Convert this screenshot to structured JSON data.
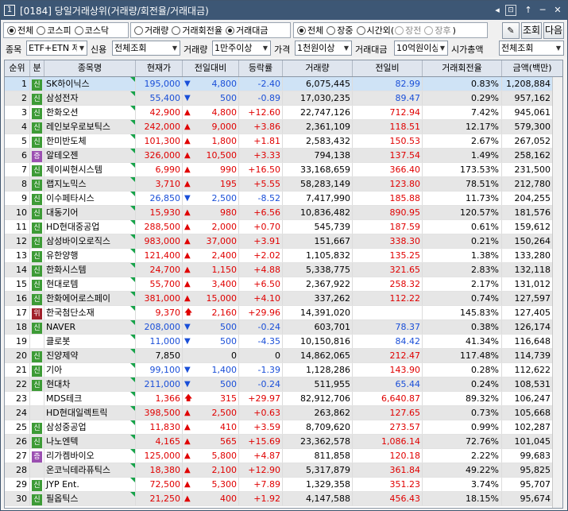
{
  "window": {
    "num": "1",
    "title": "[0184] 당일거래상위(거래량/회전율/거래대금)",
    "controls": [
      "◂",
      "▸",
      "⊡",
      "↑",
      "─",
      "✕"
    ]
  },
  "toolbar": {
    "market": [
      {
        "label": "전체",
        "on": true
      },
      {
        "label": "코스피",
        "on": false
      },
      {
        "label": "코스닥",
        "on": false
      }
    ],
    "sort": [
      {
        "label": "거래량",
        "on": false
      },
      {
        "label": "거래회전율",
        "on": false
      },
      {
        "label": "거래대금",
        "on": true
      }
    ],
    "session": [
      {
        "label": "전체",
        "on": true
      },
      {
        "label": "장중",
        "on": false
      },
      {
        "label": "시간외(",
        "on": false
      },
      {
        "label": "장전",
        "on": false,
        "dis": true
      },
      {
        "label": "장후",
        "on": false,
        "dis": true
      },
      {
        "label": ")",
        "on": false
      }
    ],
    "lookup": "조회",
    "next": "다음"
  },
  "filters": {
    "type_label": "종목",
    "type_value": "ETF+ETN 제",
    "credit_label": "신용",
    "credit_value": "전체조회",
    "volume_label": "거래량",
    "volume_value": "1만주이상",
    "price_label": "가격",
    "price_value": "1천원이상",
    "amount_label": "거래대금",
    "amount_value": "10억원이상",
    "mcap_label": "시가총액",
    "mcap_value": "전체조회"
  },
  "columns": [
    "순위",
    "분",
    "종목명",
    "현재가",
    "전일대비",
    "등락률",
    "거래량",
    "전일비",
    "거래회전율",
    "금액(백만)"
  ],
  "rows": [
    {
      "rank": "1",
      "b": "신",
      "bt": "new",
      "name": "SK하이닉스",
      "price": "195,000",
      "dir": "dn",
      "chg": "4,800",
      "rate": "-2.40",
      "vol": "6,075,445",
      "prev": "82.99",
      "turn": "0.83%",
      "amt": "1,208,884"
    },
    {
      "rank": "2",
      "b": "신",
      "bt": "new",
      "name": "삼성전자",
      "price": "55,400",
      "dir": "dn",
      "chg": "500",
      "rate": "-0.89",
      "vol": "17,030,235",
      "prev": "89.47",
      "turn": "0.29%",
      "amt": "957,162"
    },
    {
      "rank": "3",
      "b": "신",
      "bt": "new",
      "name": "한화오션",
      "price": "42,900",
      "dir": "up",
      "chg": "4,800",
      "rate": "+12.60",
      "vol": "22,747,126",
      "prev": "712.94",
      "turn": "7.42%",
      "amt": "945,061"
    },
    {
      "rank": "4",
      "b": "신",
      "bt": "new",
      "name": "레인보우로보틱스",
      "price": "242,000",
      "dir": "up",
      "chg": "9,000",
      "rate": "+3.86",
      "vol": "2,361,109",
      "prev": "118.51",
      "turn": "12.17%",
      "amt": "579,300"
    },
    {
      "rank": "5",
      "b": "신",
      "bt": "new",
      "name": "한미반도체",
      "price": "101,300",
      "dir": "up",
      "chg": "1,800",
      "rate": "+1.81",
      "vol": "2,583,432",
      "prev": "150.53",
      "turn": "2.67%",
      "amt": "267,052"
    },
    {
      "rank": "6",
      "b": "증",
      "bt": "up",
      "name": "알테오젠",
      "price": "326,000",
      "dir": "up",
      "chg": "10,500",
      "rate": "+3.33",
      "vol": "794,138",
      "prev": "137.54",
      "turn": "1.49%",
      "amt": "258,162"
    },
    {
      "rank": "7",
      "b": "신",
      "bt": "new",
      "name": "제이씨현시스템",
      "price": "6,990",
      "dir": "up",
      "chg": "990",
      "rate": "+16.50",
      "vol": "33,168,659",
      "prev": "366.40",
      "turn": "173.53%",
      "amt": "231,500"
    },
    {
      "rank": "8",
      "b": "신",
      "bt": "new",
      "name": "랩지노믹스",
      "price": "3,710",
      "dir": "up",
      "chg": "195",
      "rate": "+5.55",
      "vol": "58,283,149",
      "prev": "123.80",
      "turn": "78.51%",
      "amt": "212,780"
    },
    {
      "rank": "9",
      "b": "신",
      "bt": "new",
      "name": "이수페타시스",
      "price": "26,850",
      "dir": "dn",
      "chg": "2,500",
      "rate": "-8.52",
      "vol": "7,417,990",
      "prev": "185.88",
      "turn": "11.73%",
      "amt": "204,255"
    },
    {
      "rank": "10",
      "b": "신",
      "bt": "new",
      "name": "대동기어",
      "price": "15,930",
      "dir": "up",
      "chg": "980",
      "rate": "+6.56",
      "vol": "10,836,482",
      "prev": "890.95",
      "turn": "120.57%",
      "amt": "181,576"
    },
    {
      "rank": "11",
      "b": "신",
      "bt": "new",
      "name": "HD현대중공업",
      "price": "288,500",
      "dir": "up",
      "chg": "2,000",
      "rate": "+0.70",
      "vol": "545,739",
      "prev": "187.59",
      "turn": "0.61%",
      "amt": "159,612"
    },
    {
      "rank": "12",
      "b": "신",
      "bt": "new",
      "name": "삼성바이오로직스",
      "price": "983,000",
      "dir": "up",
      "chg": "37,000",
      "rate": "+3.91",
      "vol": "151,667",
      "prev": "338.30",
      "turn": "0.21%",
      "amt": "150,264"
    },
    {
      "rank": "13",
      "b": "신",
      "bt": "new",
      "name": "유한양행",
      "price": "121,400",
      "dir": "up",
      "chg": "2,400",
      "rate": "+2.02",
      "vol": "1,105,832",
      "prev": "135.25",
      "turn": "1.38%",
      "amt": "133,280"
    },
    {
      "rank": "14",
      "b": "신",
      "bt": "new",
      "name": "한화시스템",
      "price": "24,700",
      "dir": "up",
      "chg": "1,150",
      "rate": "+4.88",
      "vol": "5,338,775",
      "prev": "321.65",
      "turn": "2.83%",
      "amt": "132,118"
    },
    {
      "rank": "15",
      "b": "신",
      "bt": "new",
      "name": "현대로템",
      "price": "55,700",
      "dir": "up",
      "chg": "3,400",
      "rate": "+6.50",
      "vol": "2,367,922",
      "prev": "258.32",
      "turn": "2.17%",
      "amt": "131,012"
    },
    {
      "rank": "16",
      "b": "신",
      "bt": "new",
      "name": "한화에어로스페이",
      "price": "381,000",
      "dir": "up",
      "chg": "15,000",
      "rate": "+4.10",
      "vol": "337,262",
      "prev": "112.22",
      "turn": "0.74%",
      "amt": "127,597"
    },
    {
      "rank": "17",
      "b": "위",
      "bt": "risk",
      "name": "한국첨단소재",
      "price": "9,370",
      "dir": "uh",
      "chg": "2,160",
      "rate": "+29.96",
      "vol": "14,391,020",
      "prev": "",
      "turn": "145.83%",
      "amt": "127,405"
    },
    {
      "rank": "18",
      "b": "신",
      "bt": "new",
      "name": "NAVER",
      "price": "208,000",
      "dir": "dn",
      "chg": "500",
      "rate": "-0.24",
      "vol": "603,701",
      "prev": "78.37",
      "turn": "0.38%",
      "amt": "126,174"
    },
    {
      "rank": "19",
      "b": "",
      "bt": "",
      "name": "클로봇",
      "price": "11,000",
      "dir": "dn",
      "chg": "500",
      "rate": "-4.35",
      "vol": "10,150,816",
      "prev": "84.42",
      "turn": "41.34%",
      "amt": "116,648"
    },
    {
      "rank": "20",
      "b": "신",
      "bt": "new",
      "name": "진양제약",
      "price": "7,850",
      "dir": "",
      "chg": "0",
      "rate": "0",
      "vol": "14,862,065",
      "prev": "212.47",
      "turn": "117.48%",
      "amt": "114,739"
    },
    {
      "rank": "21",
      "b": "신",
      "bt": "new",
      "name": "기아",
      "price": "99,100",
      "dir": "dn",
      "chg": "1,400",
      "rate": "-1.39",
      "vol": "1,128,286",
      "prev": "143.90",
      "turn": "0.28%",
      "amt": "112,622"
    },
    {
      "rank": "22",
      "b": "신",
      "bt": "new",
      "name": "현대차",
      "price": "211,000",
      "dir": "dn",
      "chg": "500",
      "rate": "-0.24",
      "vol": "511,955",
      "prev": "65.44",
      "turn": "0.24%",
      "amt": "108,531"
    },
    {
      "rank": "23",
      "b": "",
      "bt": "",
      "name": "MDS테크",
      "price": "1,366",
      "dir": "uh",
      "chg": "315",
      "rate": "+29.97",
      "vol": "82,912,706",
      "prev": "6,640.87",
      "turn": "89.32%",
      "amt": "106,247"
    },
    {
      "rank": "24",
      "b": "",
      "bt": "",
      "name": "HD현대일렉트릭",
      "price": "398,500",
      "dir": "up",
      "chg": "2,500",
      "rate": "+0.63",
      "vol": "263,862",
      "prev": "127.65",
      "turn": "0.73%",
      "amt": "105,668"
    },
    {
      "rank": "25",
      "b": "신",
      "bt": "new",
      "name": "삼성중공업",
      "price": "11,830",
      "dir": "up",
      "chg": "410",
      "rate": "+3.59",
      "vol": "8,709,620",
      "prev": "273.57",
      "turn": "0.99%",
      "amt": "102,287"
    },
    {
      "rank": "26",
      "b": "신",
      "bt": "new",
      "name": "나노엔텍",
      "price": "4,165",
      "dir": "up",
      "chg": "565",
      "rate": "+15.69",
      "vol": "23,362,578",
      "prev": "1,086.14",
      "turn": "72.76%",
      "amt": "101,045"
    },
    {
      "rank": "27",
      "b": "증",
      "bt": "up",
      "name": "리가켐바이오",
      "price": "125,000",
      "dir": "up",
      "chg": "5,800",
      "rate": "+4.87",
      "vol": "811,858",
      "prev": "120.18",
      "turn": "2.22%",
      "amt": "99,683"
    },
    {
      "rank": "28",
      "b": "",
      "bt": "",
      "name": "온코닉테라퓨틱스",
      "price": "18,380",
      "dir": "up",
      "chg": "2,100",
      "rate": "+12.90",
      "vol": "5,317,879",
      "prev": "361.84",
      "turn": "49.22%",
      "amt": "95,825"
    },
    {
      "rank": "29",
      "b": "신",
      "bt": "new",
      "name": "JYP Ent.",
      "price": "72,500",
      "dir": "up",
      "chg": "5,300",
      "rate": "+7.89",
      "vol": "1,329,358",
      "prev": "351.23",
      "turn": "3.74%",
      "amt": "95,707"
    },
    {
      "rank": "30",
      "b": "신",
      "bt": "new",
      "name": "필옵틱스",
      "price": "21,250",
      "dir": "up",
      "chg": "400",
      "rate": "+1.92",
      "vol": "4,147,588",
      "prev": "456.43",
      "turn": "18.15%",
      "amt": "95,674"
    }
  ]
}
